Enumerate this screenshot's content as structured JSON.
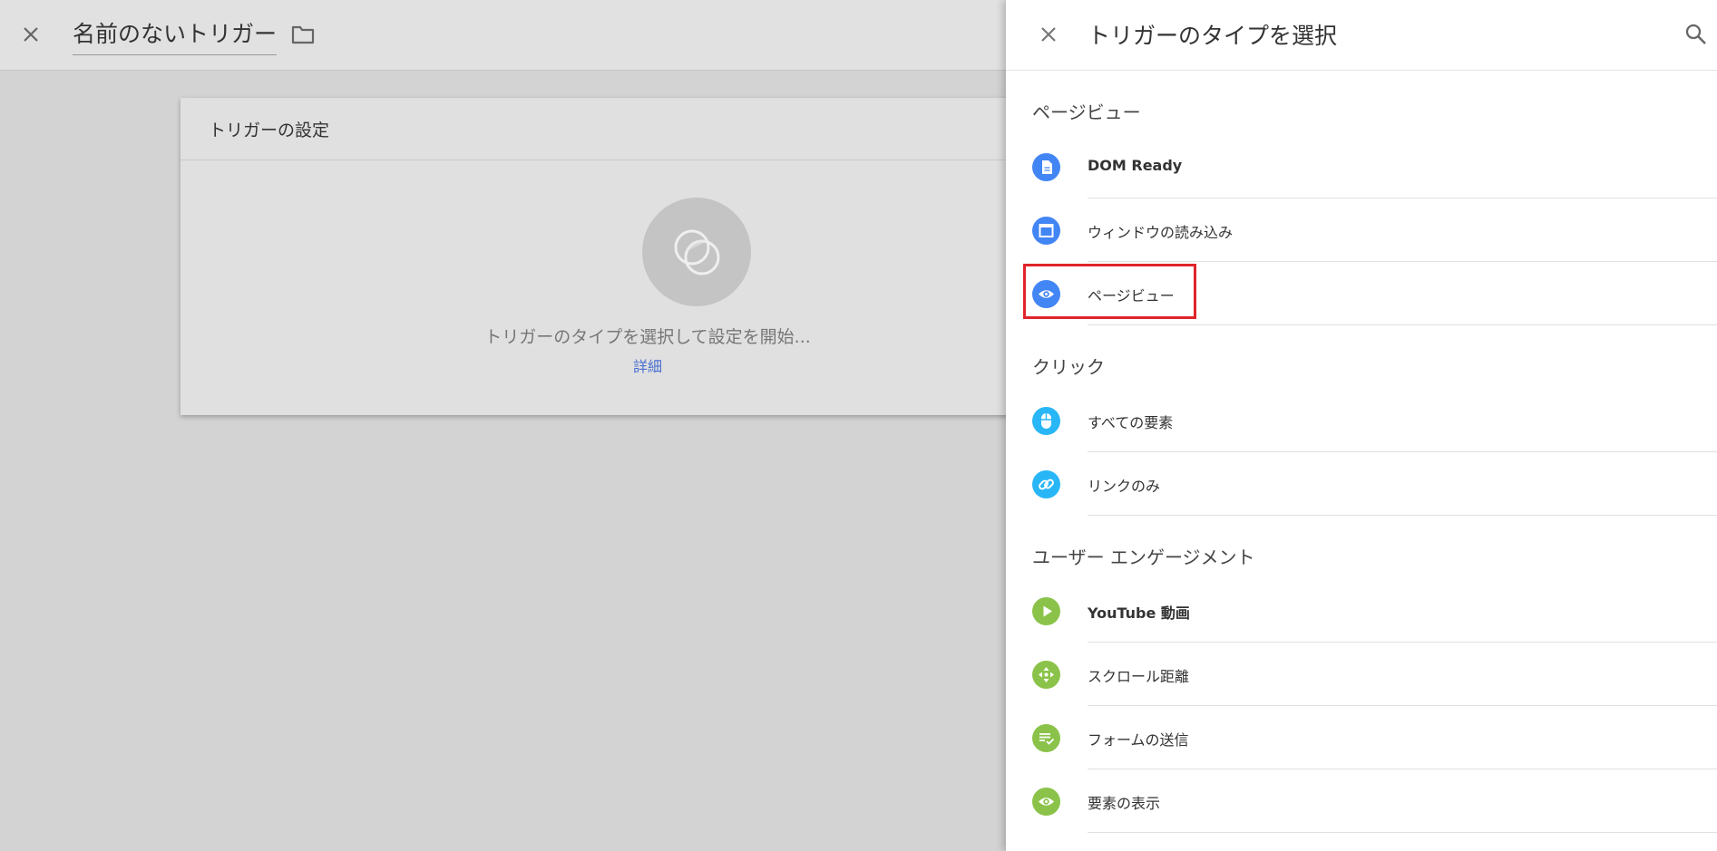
{
  "topbar": {
    "title": "名前のないトリガー",
    "close_icon": "close-icon",
    "folder_icon": "folder-icon"
  },
  "card": {
    "header": "トリガーの設定",
    "prompt": "トリガーのタイプを選択して設定を開始...",
    "more_link": "詳細",
    "placeholder_icon": "trigger-placeholder-icon"
  },
  "panel": {
    "title": "トリガーのタイプを選択",
    "close_icon": "close-icon",
    "search_icon": "search-icon",
    "sections": [
      {
        "title": "ページビュー",
        "items": [
          {
            "label": "DOM Ready",
            "icon": "document-icon",
            "color": "#4285f4"
          },
          {
            "label": "ウィンドウの読み込み",
            "icon": "window-icon",
            "color": "#4285f4"
          },
          {
            "label": "ページビュー",
            "icon": "eye-icon",
            "color": "#4285f4"
          }
        ]
      },
      {
        "title": "クリック",
        "items": [
          {
            "label": "すべての要素",
            "icon": "mouse-icon",
            "color": "#29b6f6"
          },
          {
            "label": "リンクのみ",
            "icon": "link-icon",
            "color": "#29b6f6"
          }
        ]
      },
      {
        "title": "ユーザー エンゲージメント",
        "items": [
          {
            "label": "YouTube 動画",
            "icon": "play-icon",
            "color": "#8bc34a"
          },
          {
            "label": "スクロール距離",
            "icon": "move-icon",
            "color": "#8bc34a"
          },
          {
            "label": "フォームの送信",
            "icon": "form-icon",
            "color": "#8bc34a"
          },
          {
            "label": "要素の表示",
            "icon": "eye-icon",
            "color": "#8bc34a"
          }
        ]
      }
    ]
  },
  "highlight_color": "#e0242b"
}
